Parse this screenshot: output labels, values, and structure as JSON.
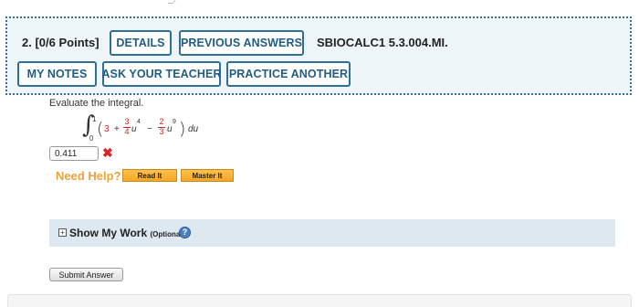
{
  "question": {
    "number": "2.",
    "points": "[0/6 Points]",
    "code": "SBIOCALC1 5.3.004.MI."
  },
  "toolbar": {
    "details_label": "DETAILS",
    "previous_answers_label": "PREVIOUS ANSWERS",
    "my_notes_label": "MY NOTES",
    "ask_teacher_label": "ASK YOUR TEACHER",
    "practice_another_label": "PRACTICE ANOTHER"
  },
  "problem": {
    "prompt": "Evaluate the integral.",
    "integral": {
      "upper_bound": "1",
      "lower_bound": "0",
      "constant": "3",
      "plus": "+",
      "coef1_num": "3",
      "coef1_den": "4",
      "var1": "u",
      "exp1": "4",
      "minus": "−",
      "coef2_num": "2",
      "coef2_den": "3",
      "var2": "u",
      "exp2": "9",
      "differential": "du"
    }
  },
  "answer": {
    "value": "0.411",
    "status": "incorrect",
    "status_icon": "x-mark-icon"
  },
  "help": {
    "label": "Need Help?",
    "read_it": "Read It",
    "master_it": "Master It"
  },
  "work": {
    "toggle_glyph": "+",
    "label": "Show My Work",
    "optional": "(Optional)",
    "help_glyph": "?"
  },
  "submit": {
    "label": "Submit Answer"
  },
  "colors": {
    "accent": "#2f6f96",
    "header_bg": "#eef5f8",
    "need_help": "#e8a33a",
    "incorrect": "#dd2222",
    "work_bg": "#dde8f1"
  }
}
